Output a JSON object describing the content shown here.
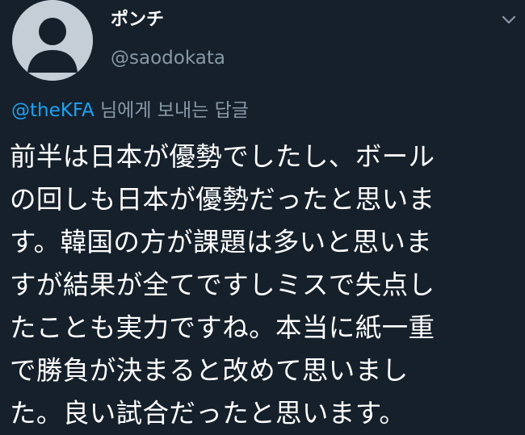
{
  "author": {
    "display_name": "ポンチ",
    "handle": "@saodokata",
    "avatar_icon": "default-avatar-icon"
  },
  "menu": {
    "icon": "chevron-down-icon"
  },
  "reply_context": {
    "mention": "@theKFA",
    "suffix": "님에게 보내는 답글"
  },
  "tweet": {
    "lines": [
      "前半は日本が優勢でしたし、ボール",
      "の回しも日本が優勢だったと思いま",
      "す。韓国の方が課題は多いと思いま",
      "すが結果が全てですしミスで失点し",
      "たことも実力ですね。本当に紙一重",
      "で勝負が決まると改めて思いまし",
      "た。良い試合だったと思います。"
    ]
  },
  "colors": {
    "background": "#15202b",
    "text": "#ffffff",
    "secondary": "#8899a6",
    "link": "#1da1f2",
    "avatar": "#c5ced6"
  }
}
